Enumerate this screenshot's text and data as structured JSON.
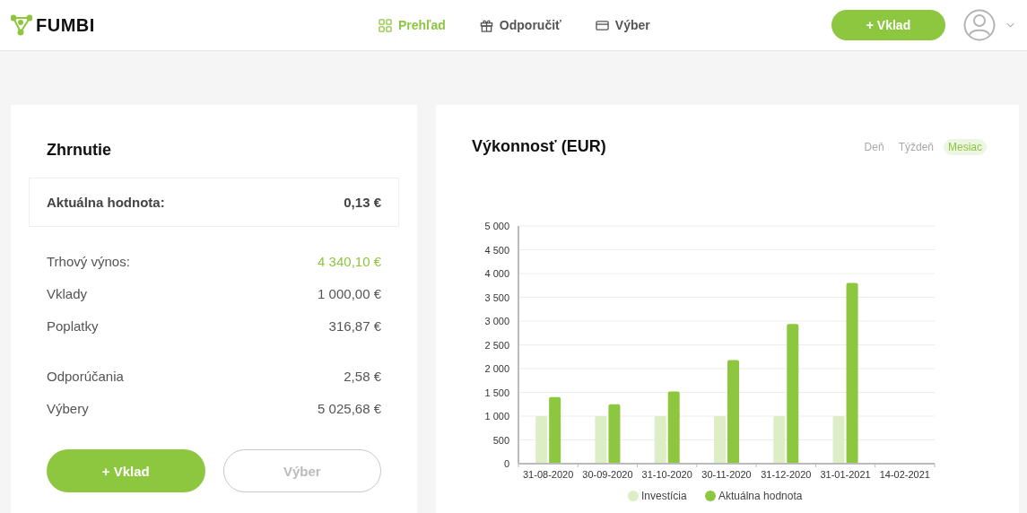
{
  "header": {
    "logo": "FUMBI",
    "nav": [
      {
        "label": "Prehľad",
        "kind": "grid",
        "selected": true
      },
      {
        "label": "Odporučiť",
        "kind": "gift",
        "selected": false
      },
      {
        "label": "Výber",
        "kind": "card",
        "selected": false
      }
    ],
    "deposit_button": "+ Vklad"
  },
  "summary": {
    "title": "Zhrnutie",
    "current": {
      "label": "Aktuálna hodnota:",
      "value": "0,13 €"
    },
    "groups": [
      [
        {
          "label": "Trhový výnos:",
          "value": "4 340,10 €",
          "highlight": true
        },
        {
          "label": "Vklady",
          "value": "1 000,00 €",
          "highlight": false
        },
        {
          "label": "Poplatky",
          "value": "316,87 €",
          "highlight": false
        }
      ],
      [
        {
          "label": "Odporúčania",
          "value": "2,58 €",
          "highlight": false
        },
        {
          "label": "Výbery",
          "value": "5 025,68 €",
          "highlight": false
        }
      ]
    ],
    "buttons": [
      {
        "label": "+ Vklad",
        "kind": "primary"
      },
      {
        "label": "Výber",
        "kind": "outline"
      }
    ]
  },
  "performance": {
    "title": "Výkonnosť (EUR)",
    "periods": [
      {
        "label": "Deň",
        "selected": false
      },
      {
        "label": "Týždeň",
        "selected": false
      },
      {
        "label": "Mesiac",
        "selected": true
      }
    ],
    "chart_data": {
      "type": "bar",
      "categories": [
        "31-08-2020",
        "30-09-2020",
        "31-10-2020",
        "30-11-2020",
        "31-12-2020",
        "31-01-2021",
        "14-02-2021"
      ],
      "ylim": [
        0,
        5000
      ],
      "grid": true,
      "legend": true,
      "yticks": [
        {
          "value": 0,
          "label": "0"
        },
        {
          "value": 500,
          "label": "500"
        },
        {
          "value": 1000,
          "label": "1 000"
        },
        {
          "value": 1500,
          "label": "1 500"
        },
        {
          "value": 2000,
          "label": "2 000"
        },
        {
          "value": 2500,
          "label": "2 500"
        },
        {
          "value": 3000,
          "label": "3 000"
        },
        {
          "value": 3500,
          "label": "3 500"
        },
        {
          "value": 4000,
          "label": "4 000"
        },
        {
          "value": 4500,
          "label": "4 500"
        },
        {
          "value": 5000,
          "label": "5 000"
        }
      ],
      "series": [
        {
          "name": "Investícia",
          "color": "#ddedc6",
          "values": [
            1000,
            1000,
            1000,
            1000,
            1000,
            1000,
            null
          ]
        },
        {
          "name": "Aktuálna hodnota",
          "color": "#8dc63f",
          "values": [
            1400,
            1250,
            1520,
            2180,
            2940,
            3800,
            null
          ]
        }
      ]
    }
  }
}
